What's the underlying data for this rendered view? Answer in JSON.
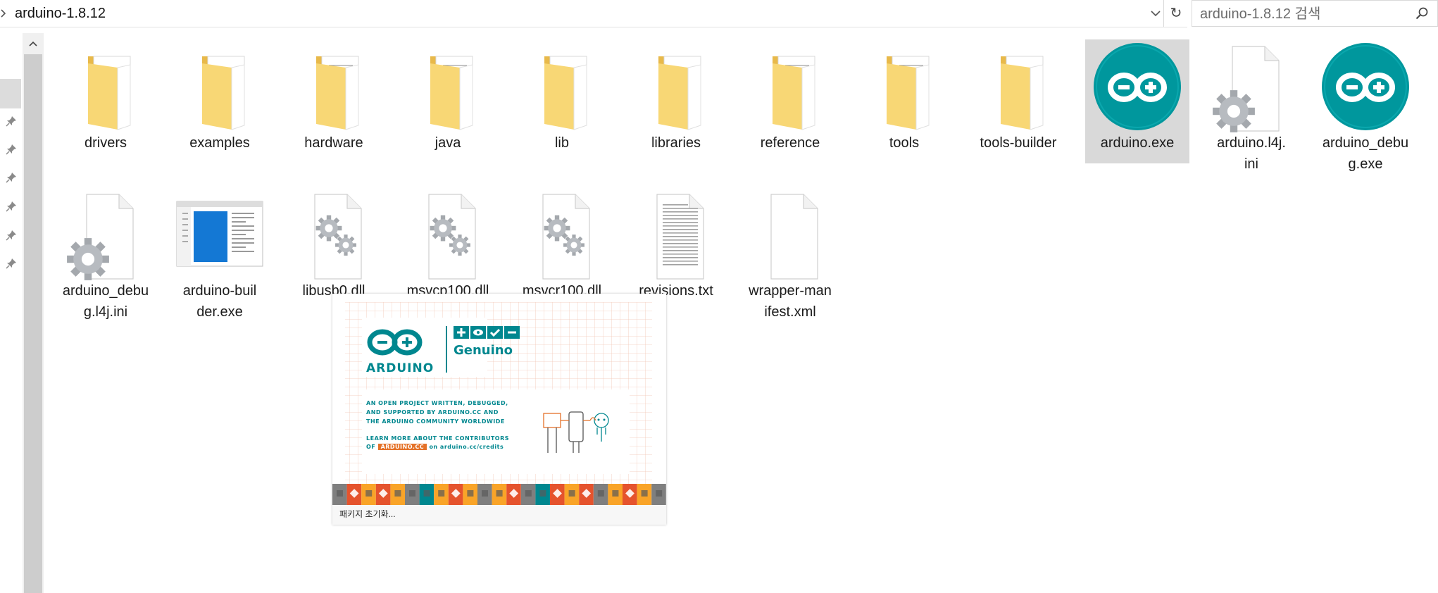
{
  "address_bar": {
    "path": "arduino-1.8.12",
    "chevron": "chevron-right-icon",
    "dropdown": "chevron-down-icon",
    "refresh_glyph": "↻"
  },
  "search": {
    "placeholder": "arduino-1.8.12 검색"
  },
  "nav": {
    "pins": 6
  },
  "items": [
    {
      "name": "drivers",
      "kind": "folder",
      "row": 0,
      "col": 0
    },
    {
      "name": "examples",
      "kind": "folder",
      "row": 0,
      "col": 1
    },
    {
      "name": "hardware",
      "kind": "folder",
      "row": 0,
      "col": 2
    },
    {
      "name": "java",
      "kind": "folder",
      "row": 0,
      "col": 3
    },
    {
      "name": "lib",
      "kind": "folder",
      "row": 0,
      "col": 4
    },
    {
      "name": "libraries",
      "kind": "folder",
      "row": 0,
      "col": 5
    },
    {
      "name": "reference",
      "kind": "folder",
      "row": 0,
      "col": 6
    },
    {
      "name": "tools",
      "kind": "folder",
      "row": 0,
      "col": 7
    },
    {
      "name": "tools-builder",
      "kind": "folder",
      "row": 0,
      "col": 8
    },
    {
      "name": "arduino.exe",
      "kind": "arduino-exe",
      "row": 0,
      "col": 9,
      "selected": true
    },
    {
      "name": "arduino.l4j.ini",
      "kind": "ini",
      "row": 0,
      "col": 10
    },
    {
      "name": "arduino_debug.exe",
      "kind": "arduino-exe",
      "row": 0,
      "col": 11
    },
    {
      "name": "arduino_debug.l4j.ini",
      "kind": "ini",
      "row": 1,
      "col": 0
    },
    {
      "name": "arduino-builder.exe",
      "kind": "app-exe",
      "row": 1,
      "col": 1
    },
    {
      "name": "libusb0.dll",
      "kind": "dll",
      "row": 1,
      "col": 2
    },
    {
      "name": "msvcp100.dll",
      "kind": "dll",
      "row": 1,
      "col": 3
    },
    {
      "name": "msvcr100.dll",
      "kind": "dll",
      "row": 1,
      "col": 4
    },
    {
      "name": "revisions.txt",
      "kind": "txt",
      "row": 1,
      "col": 5
    },
    {
      "name": "wrapper-manifest.xml",
      "kind": "blank",
      "row": 1,
      "col": 6
    }
  ],
  "splash": {
    "brand": "ARDUINO",
    "genuino": "Genuino",
    "tagline_1": "AN OPEN PROJECT WRITTEN, DEBUGGED,",
    "tagline_2": "AND SUPPORTED BY ARDUINO.CC AND",
    "tagline_3": "THE ARDUINO COMMUNITY WORLDWIDE",
    "learn_1": "LEARN MORE ABOUT THE CONTRIBUTORS",
    "learn_of": "OF",
    "learn_badge": "ARDUINO.CC",
    "learn_link": "on arduino.cc/credits",
    "status": "패키지 초기화...",
    "teal": "#00878f",
    "orange": "#e47128",
    "tile_colors": [
      "#7f7f7f",
      "#e5532d",
      "#f9a428",
      "#00878f"
    ]
  },
  "colors": {
    "folder": "#f8d775",
    "folder_dark": "#e8b94a",
    "arduino_teal": "#00979d",
    "selection": "#d9d9d9"
  }
}
